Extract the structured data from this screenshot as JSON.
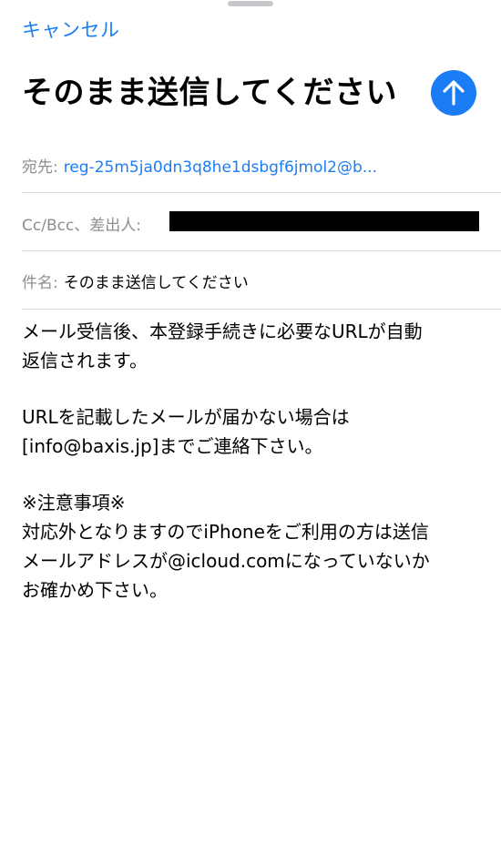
{
  "header": {
    "cancel_label": "キャンセル",
    "title": "そのまま送信してください",
    "send_icon": "arrow-up-icon"
  },
  "fields": {
    "to": {
      "label": "宛先:",
      "value": "reg-25m5ja0dn3q8he1dsbgf6jmol2@b..."
    },
    "ccbcc": {
      "label": "Cc/Bcc、差出人:"
    },
    "subject": {
      "label": "件名:",
      "value": "そのまま送信してください"
    }
  },
  "body": {
    "p1_line1": "メール受信後、本登録手続きに必要なURLが自動",
    "p1_line2": "返信されます。",
    "p2_line1": "URLを記載したメールが届かない場合は",
    "p2_line2": "[info@baxis.jp]までご連絡下さい。",
    "p3_line1": "※注意事項※",
    "p3_line2": "対応外となりますのでiPhoneをご利用の方は送信",
    "p3_line3": "メールアドレスが@icloud.comになっていないか",
    "p3_line4": "お確かめ下さい。"
  },
  "colors": {
    "accent": "#1a7df5",
    "label_gray": "#8e8e93",
    "divider": "#d9d9de"
  }
}
